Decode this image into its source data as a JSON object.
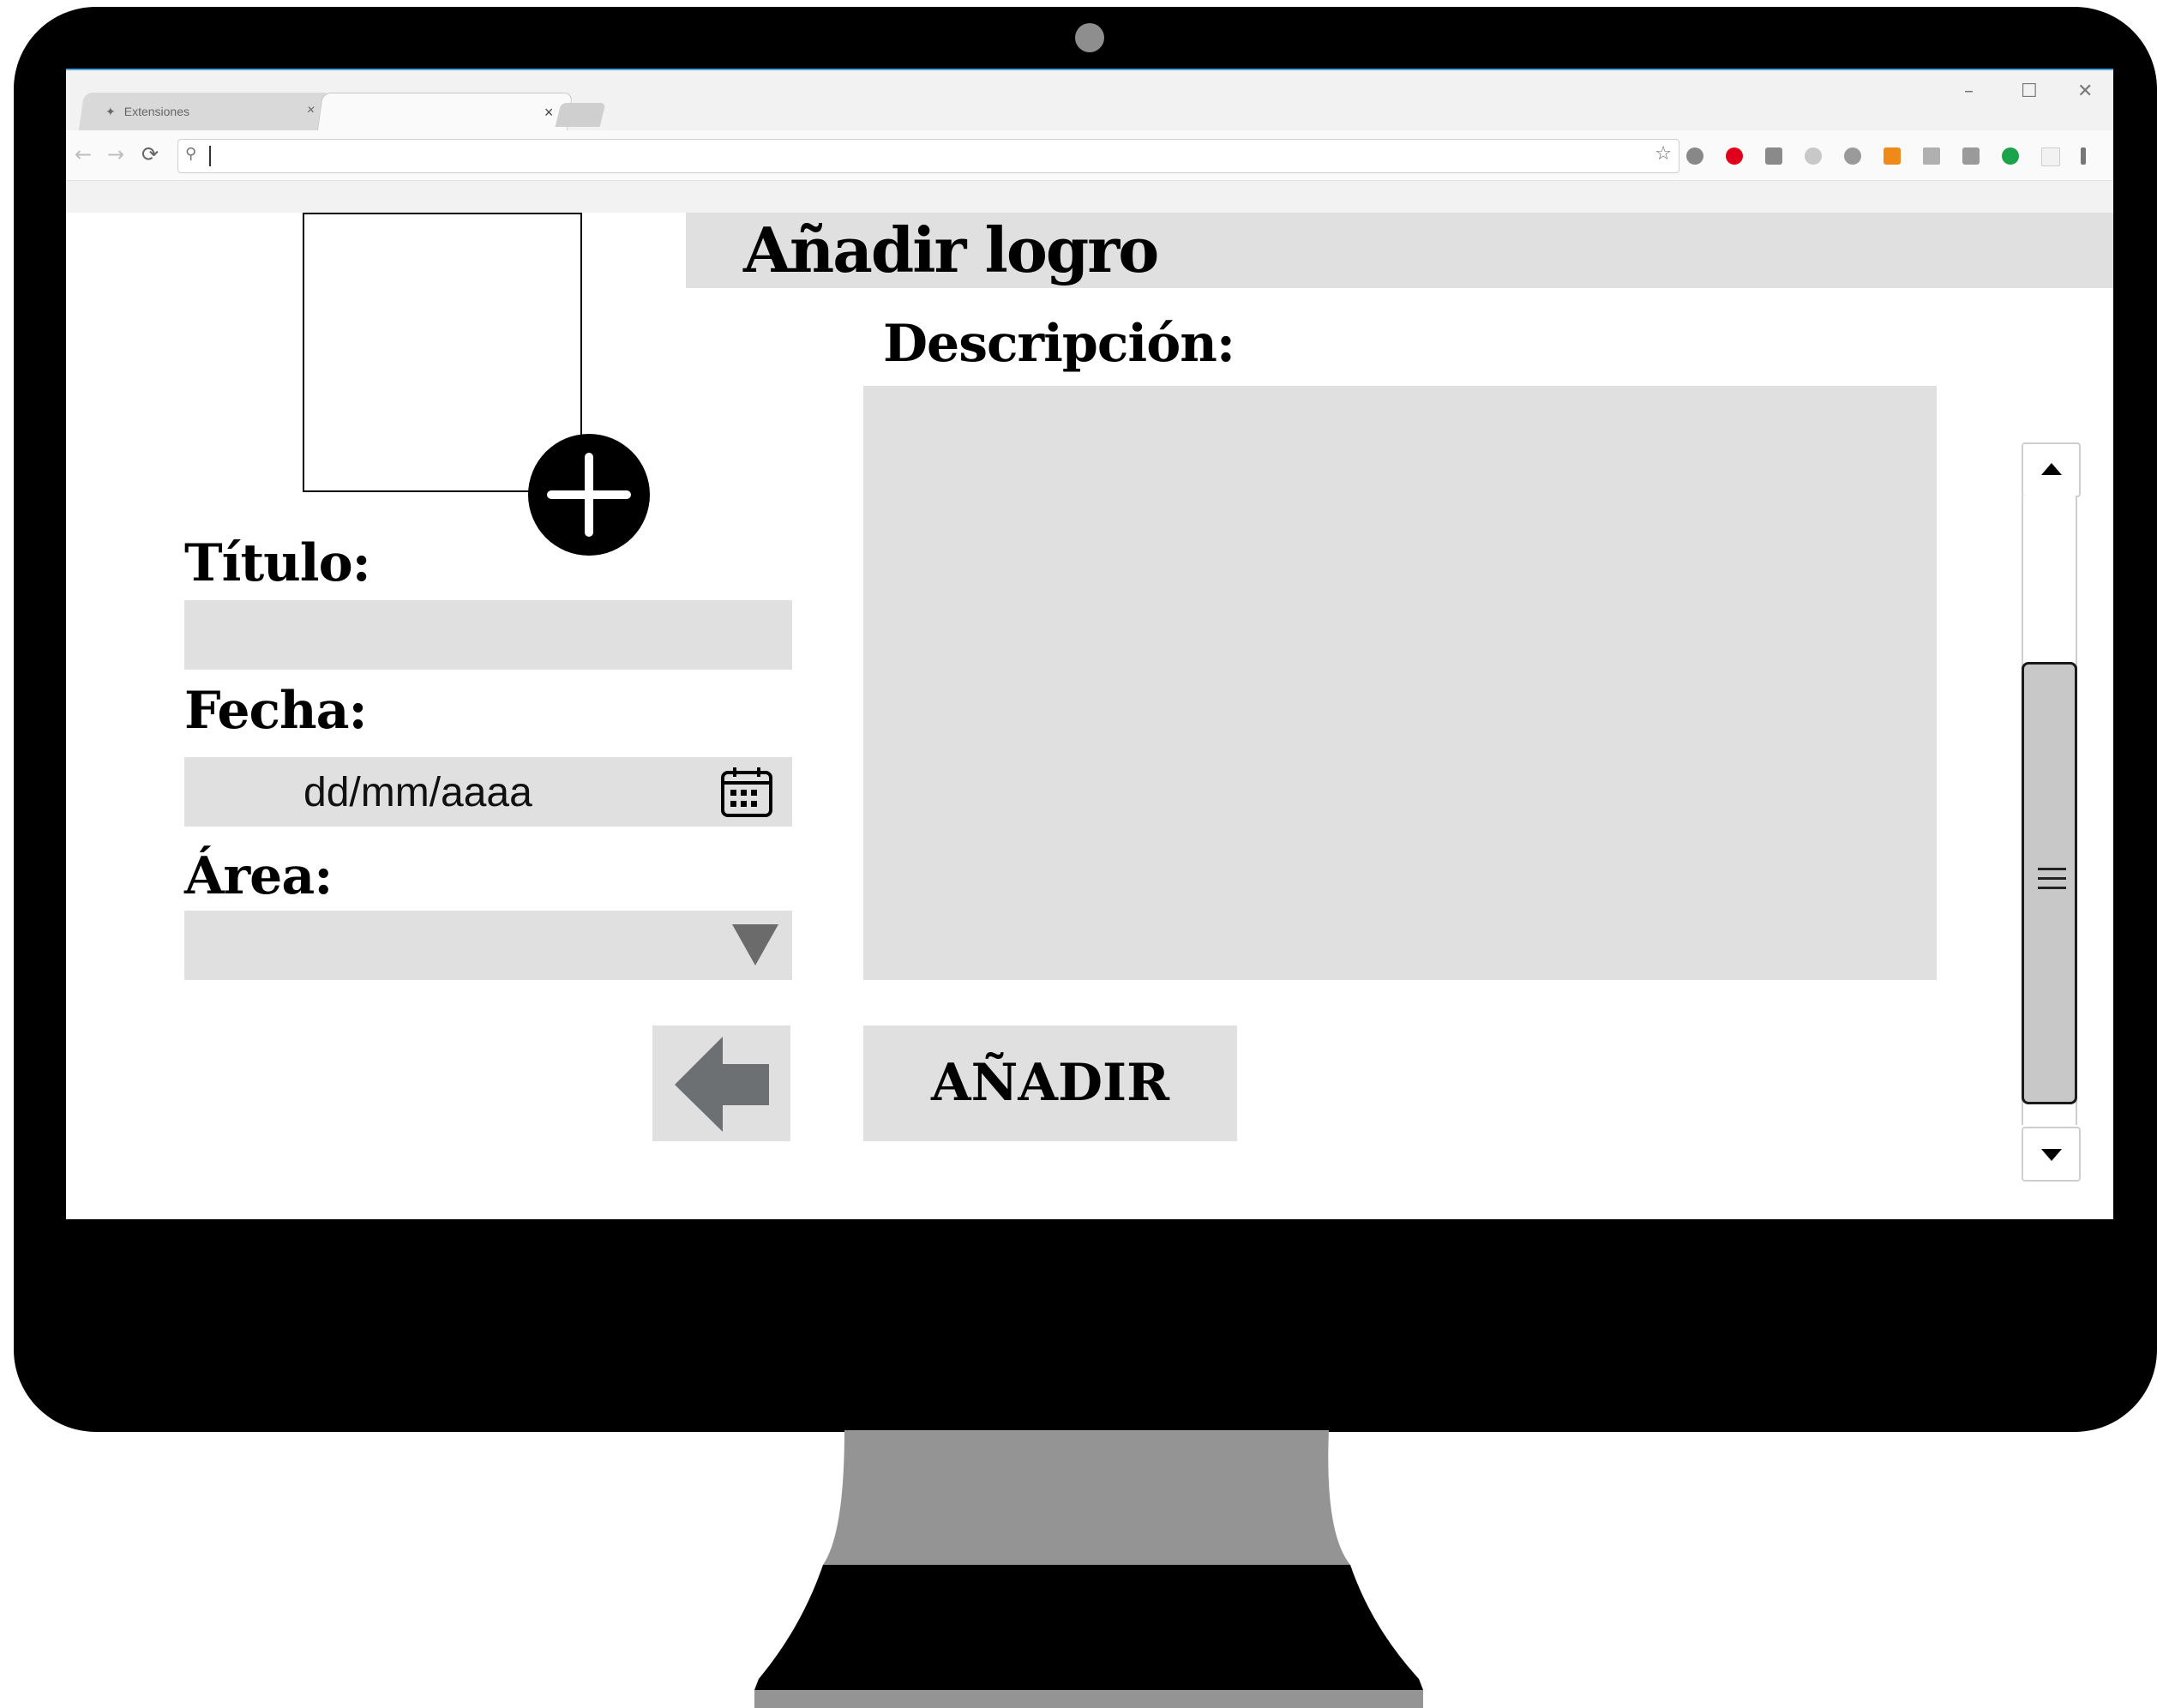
{
  "browser": {
    "tabs": [
      {
        "label": "Extensiones",
        "close": "×"
      },
      {
        "label": "",
        "close": "×"
      }
    ],
    "window_controls": {
      "minimize": "–",
      "maximize": "☐",
      "close": "✕"
    },
    "nav": {
      "back": "←",
      "forward": "→",
      "reload": "⟳"
    },
    "address": {
      "search_glyph": "⚲",
      "value": "",
      "bookmark": "☆"
    },
    "extension_icons": [
      "extension-1-icon",
      "adblock-icon",
      "extension-3-icon",
      "extension-4-icon",
      "extension-5-icon",
      "extension-6-icon",
      "extension-7-icon",
      "extension-8-icon",
      "extension-9-icon",
      "extension-10-icon"
    ]
  },
  "form": {
    "title": "Añadir logro",
    "description_label": "Descripción:",
    "title_label": "Título:",
    "date_label": "Fecha:",
    "date_placeholder": "dd/mm/aaaa",
    "area_label": "Área:",
    "add_button": "AÑADIR"
  },
  "colors": {
    "field_bg": "#e0e0e0",
    "bezel": "#000000",
    "stand": "#949494"
  }
}
